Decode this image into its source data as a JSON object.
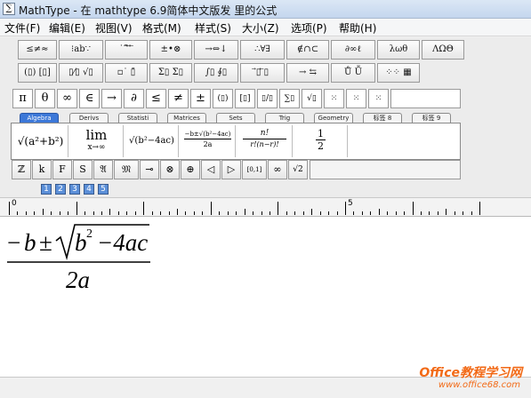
{
  "window": {
    "title": "MathType - 在 mathtype 6.9简体中文版发 里的公式",
    "app_icon_glyph": "∑"
  },
  "menu": [
    {
      "label": "文件(F)"
    },
    {
      "label": "编辑(E)"
    },
    {
      "label": "视图(V)"
    },
    {
      "label": "格式(M)"
    },
    {
      "label": "样式(S)"
    },
    {
      "label": "大小(Z)"
    },
    {
      "label": "选项(P)"
    },
    {
      "label": "帮助(H)"
    }
  ],
  "palette_row1": [
    "≤≠≈",
    "⁝ab∵",
    "˙˜⃗ ⃡ ⃖",
    "±•⊗",
    "→⇔↓",
    "∴∀∃",
    "∉∩⊂",
    "∂∞ℓ",
    "λωθ",
    "ΛΩΘ"
  ],
  "palette_row2": [
    "(▯) [▯]",
    "▯⁄▯ √▯",
    "▫˙ ▯̄",
    "Σ▯ Σ▯",
    "∫▯ ∮▯",
    "⃗▯ ⃖▯",
    "→ ⇆",
    "Ů Ṻ",
    "⁘⁘ ▦"
  ],
  "symbols": [
    "π",
    "θ",
    "∞",
    "∈",
    "→",
    "∂",
    "≤",
    "≠",
    "±",
    "(▯)",
    "[▯]",
    "▯/▯",
    "∑▯",
    "√▯",
    "⁙",
    "⁙",
    "⁙"
  ],
  "tabs": [
    "Algebra",
    "Derivs",
    "Statisti",
    "Matrices",
    "Sets",
    "Trig",
    "Geometry",
    "标签 8",
    "标签 9"
  ],
  "templates": {
    "t1": "√(a²+b²)",
    "t2_top": "lim",
    "t2_bottom": "x→∞",
    "t3": "√(b²−4ac)",
    "t4_num": "−b±√(b²−4ac)",
    "t4_den": "2a",
    "t5_num": "n!",
    "t5_den": "r!(n−r)!",
    "t6_num": "1",
    "t6_den": "2"
  },
  "greek_row": [
    "ℤ",
    "k",
    "F",
    "S",
    "𝔄",
    "𝔐",
    "⊸",
    "⊗",
    "⊕",
    "◁",
    "▷",
    "[0,1]",
    "∞",
    "√2"
  ],
  "size_buttons": [
    "1",
    "2",
    "3",
    "4",
    "5"
  ],
  "ruler": {
    "mark0": "0",
    "mark5": "5"
  },
  "equation": {
    "minus": "−",
    "b": "b",
    "pm": "±",
    "radicand_b": "b",
    "exponent": "2",
    "radicand_rest": "−4ac",
    "denominator": "2a"
  },
  "watermark": {
    "brand_en": "Office",
    "brand_cn": "教程学习网",
    "url": "www.office68.com"
  }
}
